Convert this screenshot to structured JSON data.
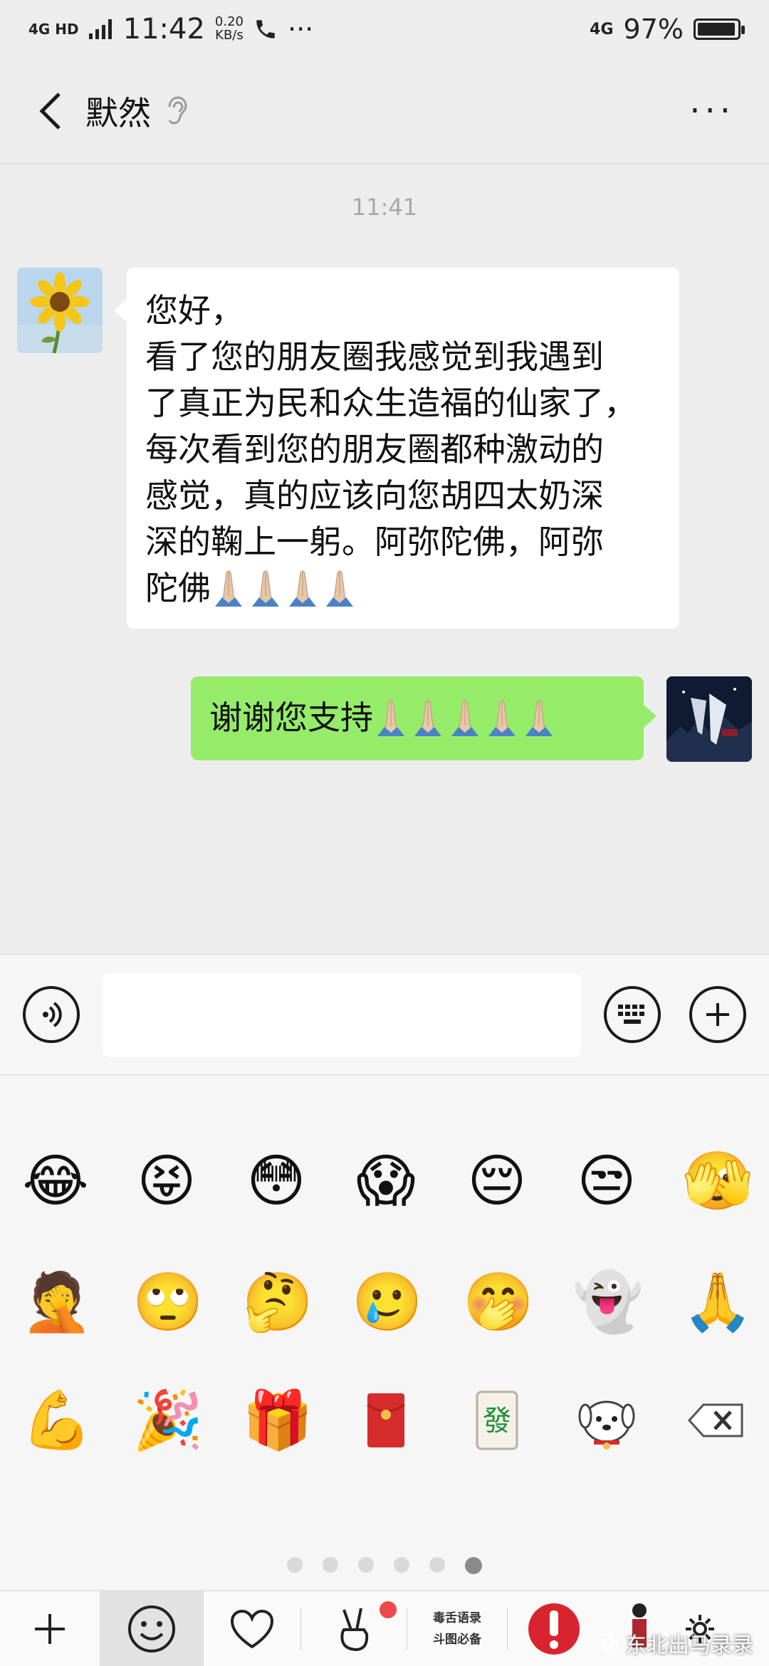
{
  "status_bar": {
    "network_left": "4G HD",
    "time": "11:42",
    "speed_value": "0.20",
    "speed_unit": "KB/s",
    "more": "···",
    "network_right": "4G",
    "battery": "97%",
    "battery_level": 0.97
  },
  "header": {
    "title": "默然",
    "more": "···"
  },
  "chat": {
    "timestamp": "11:41",
    "messages": [
      {
        "sender": "contact",
        "lines": [
          "您好，",
          "看了您的朋友圈我感觉到我遇到",
          "了真正为民和众生造福的仙家了，",
          "每次看到您的朋友圈都种激动的",
          "感觉，真的应该向您胡四太奶深",
          "深的鞠上一躬。阿弥陀佛，阿弥",
          "陀佛"
        ],
        "trailing_emoji_count": 4
      },
      {
        "sender": "self",
        "text": "谢谢您支持",
        "trailing_emoji_count": 5
      }
    ]
  },
  "input": {
    "value": "",
    "placeholder": ""
  },
  "emoji_panel": {
    "rows": [
      [
        "😂",
        "😝",
        "😳",
        "😱",
        "😔",
        "😒",
        "🫣"
      ],
      [
        "🤦",
        "🙄",
        "🤔",
        "🥲",
        "🤭",
        "👻",
        "🙏"
      ],
      [
        "💪",
        "🎉",
        "🎁",
        "red-envelope",
        "發",
        "dog-face",
        "backspace"
      ]
    ],
    "pages": 6,
    "active_page": 6
  },
  "toolbar": {
    "sticker_pack_line1": "毒舌语录",
    "sticker_pack_line2": "斗图必备"
  },
  "watermark": "东北出马录录",
  "colors": {
    "background": "#ededed",
    "incoming_bubble": "#ffffff",
    "outgoing_bubble": "#95ec69",
    "panel": "#f6f6f6"
  }
}
